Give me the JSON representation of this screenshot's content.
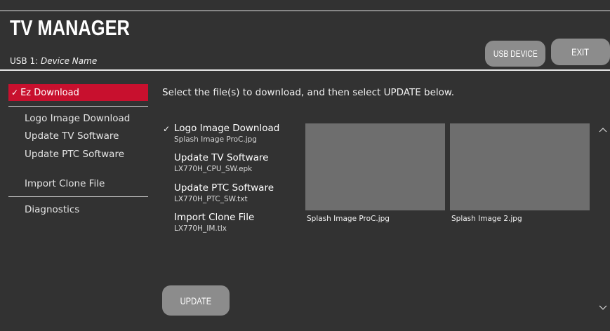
{
  "header": {
    "title": "TV MANAGER",
    "usb_prefix": "USB 1:",
    "device_name": "Device Name",
    "usb_device_button": "USB DEVICE",
    "exit_button": "EXIT"
  },
  "sidebar": {
    "selected": "Ez Download",
    "items": [
      {
        "label": "Logo Image Download"
      },
      {
        "label": "Update TV Software"
      },
      {
        "label": "Update PTC Software"
      },
      {
        "label": "Import Clone File"
      },
      {
        "label": "Diagnostics"
      }
    ]
  },
  "main": {
    "instruction": "Select the file(s) to download, and then select UPDATE below.",
    "files": [
      {
        "name": "Logo Image Download",
        "file": "Splash Image ProC.jpg",
        "checked": true
      },
      {
        "name": "Update TV Software",
        "file": "LX770H_CPU_SW.epk",
        "checked": false
      },
      {
        "name": "Update PTC Software",
        "file": "LX770H_PTC_SW.txt",
        "checked": false
      },
      {
        "name": "Import Clone File",
        "file": "LX770H_IM.tlx",
        "checked": false
      }
    ],
    "thumbnails": [
      {
        "caption": "Splash Image ProC.jpg"
      },
      {
        "caption": "Splash Image 2.jpg"
      }
    ],
    "update_button": "UPDATE"
  },
  "colors": {
    "background": "#323232",
    "accent": "#c8102e",
    "button": "#8c8c8c",
    "thumbnail": "#6e6e6e"
  }
}
